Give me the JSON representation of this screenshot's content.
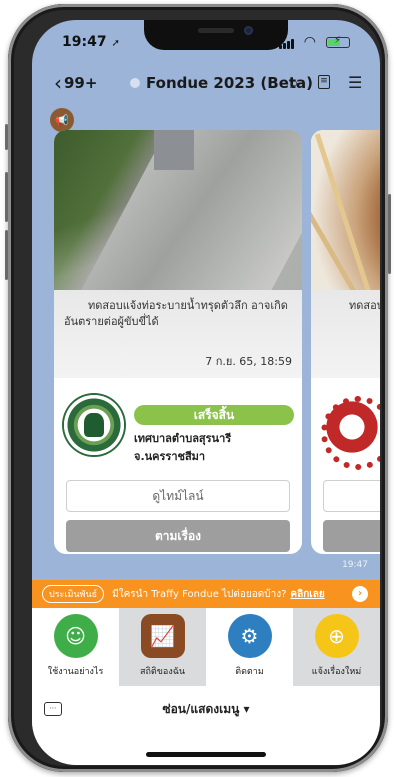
{
  "status_bar": {
    "time": "19:47",
    "location_arrow": "➚"
  },
  "nav": {
    "back_label": "99+",
    "title": "Fondue 2023 (Beta)",
    "icons": [
      "search-icon",
      "notes-icon",
      "menu-icon"
    ]
  },
  "bot": {
    "name": "Fondue"
  },
  "cards": [
    {
      "description": "ทดสอบแจ้งท่อระบายน้ำทรุดตัวลึก อาจเกิดอันตรายต่อผู้ขับขี่ได้",
      "date": "7 ก.ย. 65, 18:59",
      "status": "เสร็จสิ้น",
      "org_line1": "เทศบาลตำบลสุรนารี",
      "org_line2": "จ.นครราชสีมา",
      "timeline_label": "ดูไทม์ไลน์",
      "follow_label": "ตามเรื่อง"
    },
    {
      "description": "ทดสอบแจ้ง"
    }
  ],
  "message_time": "19:47",
  "promo": {
    "tag": "ประเมินพันธ์",
    "text": "มีใครนำ Traffy Fondue ไปต่อยอดบ้าง?",
    "link": "คลิกเลย"
  },
  "menu": [
    {
      "label": "ใช้งานอย่างไร",
      "color": "#3fae49",
      "icon": "help-icon"
    },
    {
      "label": "สถิติของฉัน",
      "color": "#8a4b24",
      "icon": "stats-icon"
    },
    {
      "label": "ติดตาม",
      "color": "#2d7fbf",
      "icon": "track-icon"
    },
    {
      "label": "แจ้งเรื่องใหม่",
      "color": "#f5c518",
      "icon": "add-icon"
    }
  ],
  "bottom": {
    "toggle_label": "ซ่อน/แสดงเมนู ▾"
  }
}
